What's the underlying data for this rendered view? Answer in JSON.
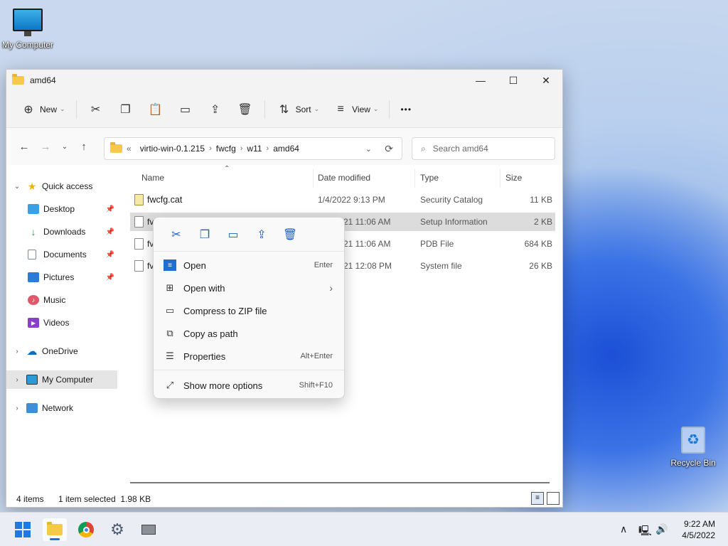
{
  "desktop": {
    "icons": [
      {
        "label": "My Computer"
      },
      {
        "label": "Recycle Bin"
      }
    ]
  },
  "window": {
    "title": "amd64",
    "controls": {
      "minimize": "—",
      "maximize": "☐",
      "close": "✕"
    }
  },
  "toolbar": {
    "new_label": "New",
    "sort_label": "Sort",
    "view_label": "View",
    "more_label": "•••"
  },
  "address": {
    "overflow": "«",
    "crumbs": [
      "virtio-win-0.1.215",
      "fwcfg",
      "w11",
      "amd64"
    ],
    "search_placeholder": "Search amd64"
  },
  "sidebar": {
    "items": [
      {
        "label": "Quick access"
      },
      {
        "label": "Desktop"
      },
      {
        "label": "Downloads"
      },
      {
        "label": "Documents"
      },
      {
        "label": "Pictures"
      },
      {
        "label": "Music"
      },
      {
        "label": "Videos"
      },
      {
        "label": "OneDrive"
      },
      {
        "label": "My Computer"
      },
      {
        "label": "Network"
      }
    ]
  },
  "columns": {
    "name": "Name",
    "date": "Date modified",
    "type": "Type",
    "size": "Size"
  },
  "files": [
    {
      "name": "fwcfg.cat",
      "date": "1/4/2022 9:13 PM",
      "type": "Security Catalog",
      "size": "11 KB"
    },
    {
      "name": "fv",
      "date": "21 11:06 AM",
      "type": "Setup Information",
      "size": "2 KB"
    },
    {
      "name": "fv",
      "date": "21 11:06 AM",
      "type": "PDB File",
      "size": "684 KB"
    },
    {
      "name": "fv",
      "date": "21 12:08 PM",
      "type": "System file",
      "size": "26 KB"
    }
  ],
  "status": {
    "count": "4 items",
    "selection": "1 item selected  1.98 KB"
  },
  "context_menu": {
    "items": [
      {
        "label": "Open",
        "shortcut": "Enter"
      },
      {
        "label": "Open with",
        "shortcut": "›"
      },
      {
        "label": "Compress to ZIP file",
        "shortcut": ""
      },
      {
        "label": "Copy as path",
        "shortcut": ""
      },
      {
        "label": "Properties",
        "shortcut": "Alt+Enter"
      },
      {
        "label": "Show more options",
        "shortcut": "Shift+F10"
      }
    ]
  },
  "taskbar": {
    "time": "9:22 AM",
    "date": "4/5/2022"
  },
  "colors": {
    "accent": "#1e6fd6",
    "selection": "#dcdcdc",
    "folder": "#f7c948"
  }
}
